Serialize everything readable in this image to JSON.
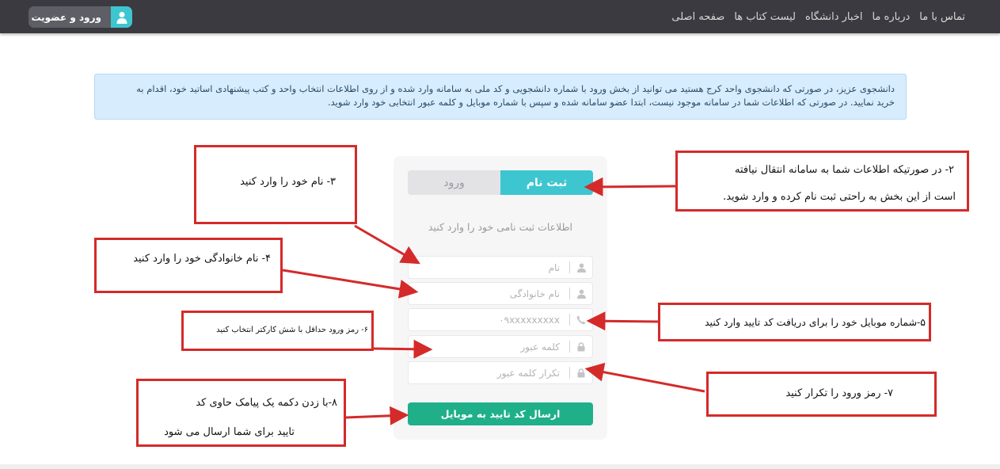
{
  "navbar": {
    "links": [
      "صفحه اصلی",
      "لیست کتاب ها",
      "اخبار دانشگاه",
      "درباره ما",
      "تماس با ما"
    ],
    "login_button": "ورود و عضویت",
    "login_icon": "user-icon"
  },
  "alert": {
    "line1": "دانشجوی عزیز، در صورتی که دانشجوی واحد کرج هستید می توانید از بخش ورود با شماره دانشجویی و کد ملی به سامانه وارد شده و از روی اطلاعات انتخاب واحد و کتب پیشنهادی اساتید خود، اقدام به",
    "line2": "خرید نمایید. در صورتی که اطلاعات شما در سامانه موجود نیست، ابتدا عضو سامانه شده و سپس با شماره موبایل و کلمه عبور انتخابی خود وارد شوید."
  },
  "form": {
    "tab_register": "ثبت نام",
    "tab_login": "ورود",
    "heading": "اطلاعات ثبت نامی خود را وارد کنید",
    "fields": [
      {
        "placeholder": "نام",
        "icon": "user-icon"
      },
      {
        "placeholder": "نام خانوادگی",
        "icon": "user-icon"
      },
      {
        "placeholder": "۰۹xxxxxxxxx",
        "icon": "phone-icon"
      },
      {
        "placeholder": "کلمه عبور",
        "icon": "lock-icon"
      },
      {
        "placeholder": "تکرار کلمه عبور",
        "icon": "lock-icon"
      }
    ],
    "submit": "ارسال کد تایید به موبایل"
  },
  "annotations": {
    "note2": {
      "line1": "۲- در صورتیکه اطلاعات شما به سامانه انتقال نیافته",
      "line2": "است از این بخش به راحتی ثبت نام کرده و وارد شوید."
    },
    "note3": {
      "line1": "۳- نام خود را  وارد کنید"
    },
    "note4": {
      "line1": "۴- نام خانوادگی خود را وارد کنید"
    },
    "note5": {
      "line1": "۵-شماره موبایل خود را برای دریافت کد تایید وارد کنید"
    },
    "note6": {
      "line1": "۶- رمز ورود حداقل با شش کارکتر انتخاب کنید"
    },
    "note7": {
      "line1": "۷- رمز ورود را تکرار کنید"
    },
    "note8": {
      "line1": "۸-با زدن دکمه یک  پیامک حاوی کد",
      "line2": "تایید برای شما ارسال می شود"
    }
  },
  "colors": {
    "navbar": "#3a3a40",
    "accent": "#3ec6d0",
    "submit": "#1fb08a",
    "annotation": "#d42a2a"
  }
}
